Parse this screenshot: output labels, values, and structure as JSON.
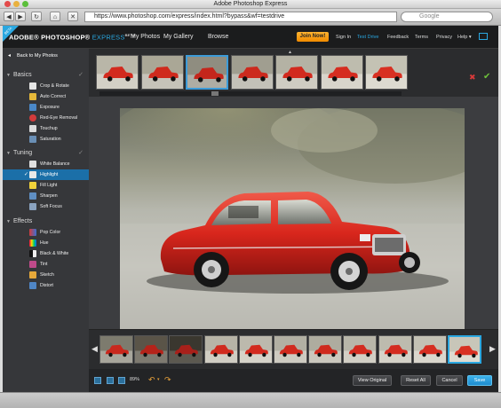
{
  "browser": {
    "title": "Adobe Photoshop Express",
    "url": "https://www.photoshop.com/express/index.html?bypass&wf=testdrive",
    "search_placeholder": "Google"
  },
  "app": {
    "beta_flag": "BETA",
    "logo": "ADOBE® PHOTOSHOP® EXPRESS",
    "logo_parts": {
      "brand": "ADOBE® PHOTOSHOP®",
      "product": "EXPRESS",
      "tag": "BETA"
    },
    "nav": [
      "My Photos",
      "My Gallery",
      "Browse"
    ],
    "join_now": "Join Now!",
    "links": [
      "Sign In",
      "Test Drive",
      "Feedback",
      "Terms",
      "Privacy",
      "Help ▾"
    ],
    "accent": "#2aa7e0"
  },
  "sidebar": {
    "back": "Back to My Photos",
    "sections": [
      {
        "name": "Basics",
        "tools": [
          "Crop & Rotate",
          "Auto Correct",
          "Exposure",
          "Red-Eye Removal",
          "Touchup",
          "Saturation"
        ]
      },
      {
        "name": "Tuning",
        "tools": [
          "White Balance",
          "Highlight",
          "Fill Light",
          "Sharpen",
          "Soft Focus"
        ]
      },
      {
        "name": "Effects",
        "tools": [
          "Pop Color",
          "Hue",
          "Black & White",
          "Tint",
          "Sketch",
          "Distort"
        ]
      }
    ],
    "active_tool": "Highlight"
  },
  "bottombar": {
    "zoom": "89%",
    "view_original": "View Original",
    "reset_all": "Reset All",
    "cancel": "Cancel",
    "save": "Save"
  },
  "options_count": 7,
  "film_count": 11
}
